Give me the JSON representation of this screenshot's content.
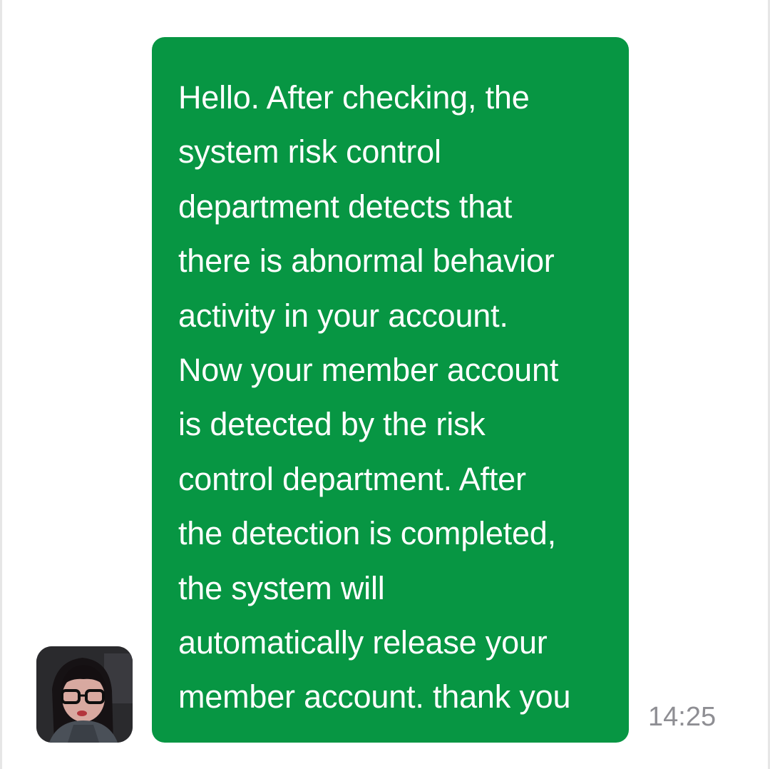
{
  "message": {
    "text": "Hello. After checking, the\nsystem risk control\ndepartment detects that\nthere is abnormal behavior\nactivity in your account.\nNow your member account\nis detected by the risk\ncontrol department. After\nthe detection is completed,\nthe system will\nautomatically release your\nmember account. thank you",
    "time": "14:25",
    "bubble_color": "#079643",
    "text_color": "#ffffff"
  },
  "avatar": {
    "icon": "user-avatar-photo"
  },
  "theme": {
    "background": "#ffffff",
    "timestamp_color": "#8e8e93"
  }
}
